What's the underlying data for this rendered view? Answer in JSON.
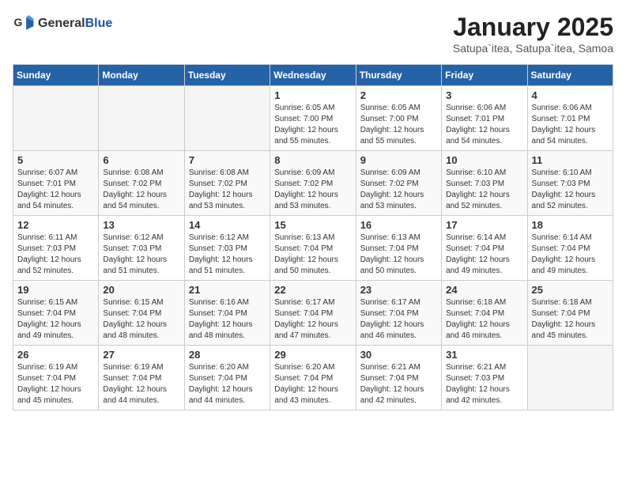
{
  "header": {
    "logo_general": "General",
    "logo_blue": "Blue",
    "month_title": "January 2025",
    "subtitle": "Satupa`itea, Satupa`itea, Samoa"
  },
  "days_of_week": [
    "Sunday",
    "Monday",
    "Tuesday",
    "Wednesday",
    "Thursday",
    "Friday",
    "Saturday"
  ],
  "weeks": [
    [
      {
        "day": "",
        "empty": true
      },
      {
        "day": "",
        "empty": true
      },
      {
        "day": "",
        "empty": true
      },
      {
        "day": "1",
        "sunrise": "6:05 AM",
        "sunset": "7:00 PM",
        "daylight": "12 hours and 55 minutes."
      },
      {
        "day": "2",
        "sunrise": "6:05 AM",
        "sunset": "7:00 PM",
        "daylight": "12 hours and 55 minutes."
      },
      {
        "day": "3",
        "sunrise": "6:06 AM",
        "sunset": "7:01 PM",
        "daylight": "12 hours and 54 minutes."
      },
      {
        "day": "4",
        "sunrise": "6:06 AM",
        "sunset": "7:01 PM",
        "daylight": "12 hours and 54 minutes."
      }
    ],
    [
      {
        "day": "5",
        "sunrise": "6:07 AM",
        "sunset": "7:01 PM",
        "daylight": "12 hours and 54 minutes."
      },
      {
        "day": "6",
        "sunrise": "6:08 AM",
        "sunset": "7:02 PM",
        "daylight": "12 hours and 54 minutes."
      },
      {
        "day": "7",
        "sunrise": "6:08 AM",
        "sunset": "7:02 PM",
        "daylight": "12 hours and 53 minutes."
      },
      {
        "day": "8",
        "sunrise": "6:09 AM",
        "sunset": "7:02 PM",
        "daylight": "12 hours and 53 minutes."
      },
      {
        "day": "9",
        "sunrise": "6:09 AM",
        "sunset": "7:02 PM",
        "daylight": "12 hours and 53 minutes."
      },
      {
        "day": "10",
        "sunrise": "6:10 AM",
        "sunset": "7:03 PM",
        "daylight": "12 hours and 52 minutes."
      },
      {
        "day": "11",
        "sunrise": "6:10 AM",
        "sunset": "7:03 PM",
        "daylight": "12 hours and 52 minutes."
      }
    ],
    [
      {
        "day": "12",
        "sunrise": "6:11 AM",
        "sunset": "7:03 PM",
        "daylight": "12 hours and 52 minutes."
      },
      {
        "day": "13",
        "sunrise": "6:12 AM",
        "sunset": "7:03 PM",
        "daylight": "12 hours and 51 minutes."
      },
      {
        "day": "14",
        "sunrise": "6:12 AM",
        "sunset": "7:03 PM",
        "daylight": "12 hours and 51 minutes."
      },
      {
        "day": "15",
        "sunrise": "6:13 AM",
        "sunset": "7:04 PM",
        "daylight": "12 hours and 50 minutes."
      },
      {
        "day": "16",
        "sunrise": "6:13 AM",
        "sunset": "7:04 PM",
        "daylight": "12 hours and 50 minutes."
      },
      {
        "day": "17",
        "sunrise": "6:14 AM",
        "sunset": "7:04 PM",
        "daylight": "12 hours and 49 minutes."
      },
      {
        "day": "18",
        "sunrise": "6:14 AM",
        "sunset": "7:04 PM",
        "daylight": "12 hours and 49 minutes."
      }
    ],
    [
      {
        "day": "19",
        "sunrise": "6:15 AM",
        "sunset": "7:04 PM",
        "daylight": "12 hours and 49 minutes."
      },
      {
        "day": "20",
        "sunrise": "6:15 AM",
        "sunset": "7:04 PM",
        "daylight": "12 hours and 48 minutes."
      },
      {
        "day": "21",
        "sunrise": "6:16 AM",
        "sunset": "7:04 PM",
        "daylight": "12 hours and 48 minutes."
      },
      {
        "day": "22",
        "sunrise": "6:17 AM",
        "sunset": "7:04 PM",
        "daylight": "12 hours and 47 minutes."
      },
      {
        "day": "23",
        "sunrise": "6:17 AM",
        "sunset": "7:04 PM",
        "daylight": "12 hours and 46 minutes."
      },
      {
        "day": "24",
        "sunrise": "6:18 AM",
        "sunset": "7:04 PM",
        "daylight": "12 hours and 46 minutes."
      },
      {
        "day": "25",
        "sunrise": "6:18 AM",
        "sunset": "7:04 PM",
        "daylight": "12 hours and 45 minutes."
      }
    ],
    [
      {
        "day": "26",
        "sunrise": "6:19 AM",
        "sunset": "7:04 PM",
        "daylight": "12 hours and 45 minutes."
      },
      {
        "day": "27",
        "sunrise": "6:19 AM",
        "sunset": "7:04 PM",
        "daylight": "12 hours and 44 minutes."
      },
      {
        "day": "28",
        "sunrise": "6:20 AM",
        "sunset": "7:04 PM",
        "daylight": "12 hours and 44 minutes."
      },
      {
        "day": "29",
        "sunrise": "6:20 AM",
        "sunset": "7:04 PM",
        "daylight": "12 hours and 43 minutes."
      },
      {
        "day": "30",
        "sunrise": "6:21 AM",
        "sunset": "7:04 PM",
        "daylight": "12 hours and 42 minutes."
      },
      {
        "day": "31",
        "sunrise": "6:21 AM",
        "sunset": "7:03 PM",
        "daylight": "12 hours and 42 minutes."
      },
      {
        "day": "",
        "empty": true
      }
    ]
  ]
}
